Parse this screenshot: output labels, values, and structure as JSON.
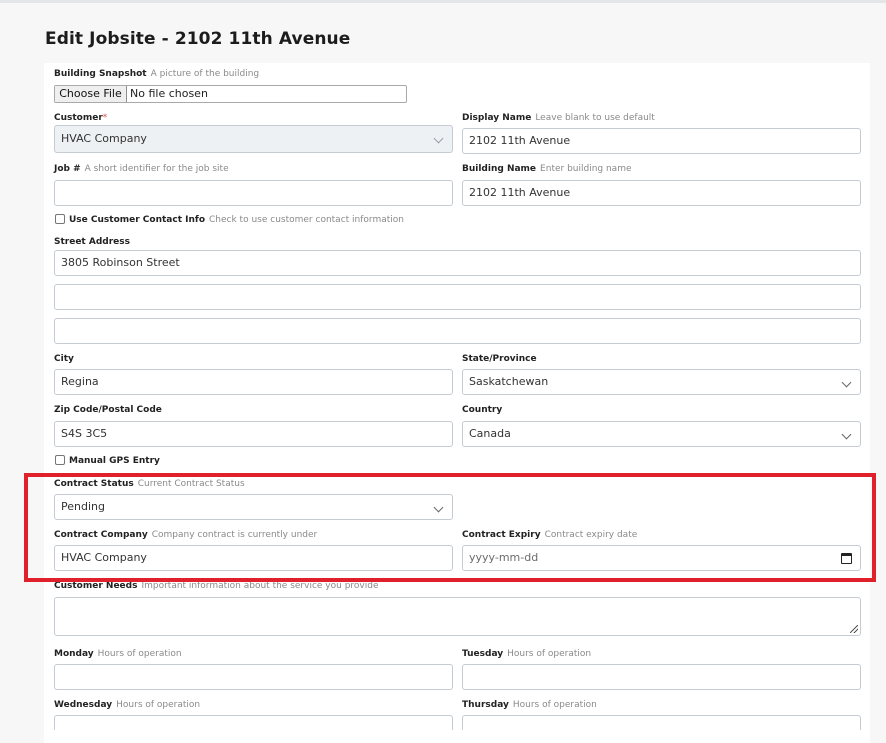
{
  "page": {
    "title": "Edit Jobsite - 2102 11th Avenue"
  },
  "form": {
    "building_snapshot": {
      "label": "Building Snapshot",
      "hint": "A picture of the building",
      "button": "Choose File",
      "status": "No file chosen"
    },
    "customer": {
      "label": "Customer",
      "required_mark": "*",
      "value": "HVAC Company"
    },
    "display_name": {
      "label": "Display Name",
      "hint": "Leave blank to use default",
      "value": "2102 11th Avenue"
    },
    "job_number": {
      "label": "Job #",
      "hint": "A short identifier for the job site",
      "value": ""
    },
    "building_name": {
      "label": "Building Name",
      "hint": "Enter building name",
      "value": "2102 11th Avenue"
    },
    "use_customer_contact": {
      "label": "Use Customer Contact Info",
      "hint": "Check to use customer contact information",
      "checked": false
    },
    "street_address": {
      "label": "Street Address",
      "line1": "3805 Robinson Street",
      "line2": "",
      "line3": ""
    },
    "city": {
      "label": "City",
      "value": "Regina"
    },
    "state": {
      "label": "State/Province",
      "value": "Saskatchewan"
    },
    "zip": {
      "label": "Zip Code/Postal Code",
      "value": "S4S 3C5"
    },
    "country": {
      "label": "Country",
      "value": "Canada"
    },
    "manual_gps": {
      "label": "Manual GPS Entry",
      "checked": false
    },
    "contract_status": {
      "label": "Contract Status",
      "hint": "Current Contract Status",
      "value": "Pending"
    },
    "contract_company": {
      "label": "Contract Company",
      "hint": "Company contract is currently under",
      "value": "HVAC Company"
    },
    "contract_expiry": {
      "label": "Contract Expiry",
      "hint": "Contract expiry date",
      "placeholder": "yyyy-mm-dd"
    },
    "customer_needs": {
      "label": "Customer Needs",
      "hint": "Important information about the service you provide"
    },
    "monday": {
      "label": "Monday",
      "hint": "Hours of operation",
      "value": ""
    },
    "tuesday": {
      "label": "Tuesday",
      "hint": "Hours of operation",
      "value": ""
    },
    "wednesday": {
      "label": "Wednesday",
      "hint": "Hours of operation",
      "value": ""
    },
    "thursday": {
      "label": "Thursday",
      "hint": "Hours of operation",
      "value": ""
    }
  },
  "colors": {
    "highlight": "#e0202a",
    "required": "#d9534f",
    "hint": "#8a8a8a",
    "input_border": "#c5cbd2"
  }
}
